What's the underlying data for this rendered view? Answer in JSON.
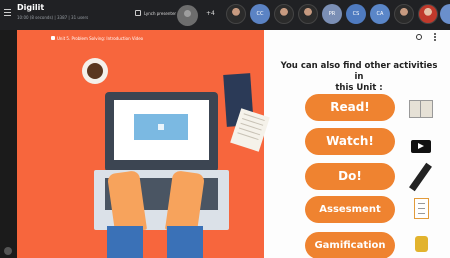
{
  "app": {
    "title": "Digilit",
    "subtitle": "10:00 (8 seconds) | 3387 | 31 users",
    "presenter_label": "Lynch presenter",
    "more_participants": "+4"
  },
  "participants": [
    {
      "type": "photo"
    },
    {
      "type": "initials",
      "initials": "CC"
    },
    {
      "type": "photo"
    },
    {
      "type": "photo"
    },
    {
      "type": "initials",
      "initials": "PR"
    },
    {
      "type": "initials",
      "initials": "CS"
    },
    {
      "type": "initials",
      "initials": "CA"
    },
    {
      "type": "photo"
    },
    {
      "type": "photo"
    },
    {
      "type": "initials",
      "initials": "CA"
    }
  ],
  "video": {
    "title": "Unit 5. Problem Solving: Introduction Video"
  },
  "slide": {
    "heading_line1": "You can also find other activities in",
    "heading_line2": "this Unit :",
    "activities": [
      {
        "label": "Read!",
        "icon": "book-icon"
      },
      {
        "label": "Watch!",
        "icon": "play-icon"
      },
      {
        "label": "Do!",
        "icon": "pencil-icon"
      },
      {
        "label": "Assesment",
        "icon": "clipboard-icon"
      },
      {
        "label": "Gamification",
        "icon": "badge-icon"
      }
    ]
  },
  "colors": {
    "orange_panel": "#f7663d",
    "button_orange": "#ef8330",
    "topbar": "#202124"
  }
}
